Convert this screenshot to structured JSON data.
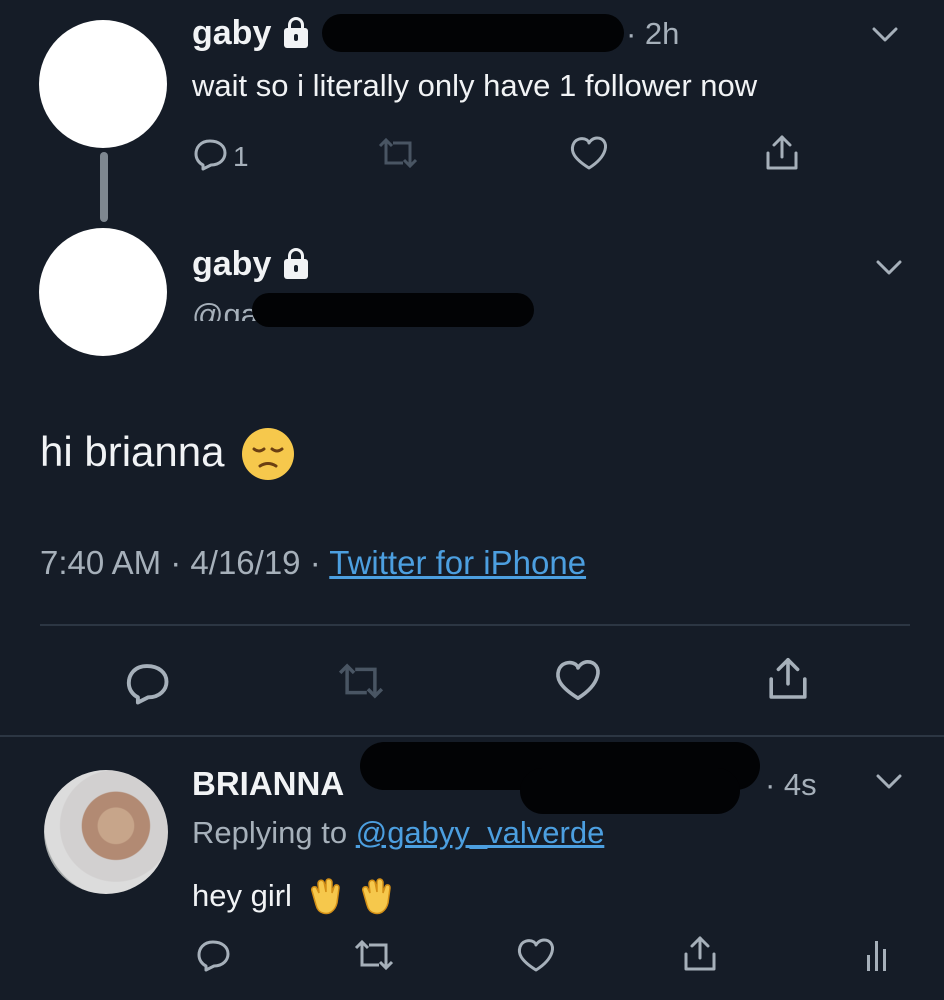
{
  "tweet1": {
    "author": "gaby",
    "time": "· 2h",
    "text": "wait so i literally only have 1 follower now",
    "reply_count": "1"
  },
  "tweet2": {
    "author": "gaby",
    "handle_partial": "@ga",
    "text": "hi brianna",
    "time": "7:40 AM",
    "date": "4/16/19",
    "source": "Twitter for iPhone"
  },
  "reply": {
    "author": "BRIANNA",
    "time": "· 4s",
    "replying_prefix": "Replying to",
    "replying_handle": "@gabyy_valverde",
    "text": "hey girl"
  },
  "colors": {
    "background": "#151c27",
    "accent": "#4c9fe0",
    "text": "#f1f3f5",
    "muted": "#a6b0ba",
    "divider": "#2c3643"
  },
  "icons": [
    "reply-icon",
    "retweet-icon",
    "like-icon",
    "share-icon",
    "chevron-down-icon",
    "lock-icon",
    "pensive-emoji",
    "waving-hand-emoji",
    "analytics-icon"
  ]
}
